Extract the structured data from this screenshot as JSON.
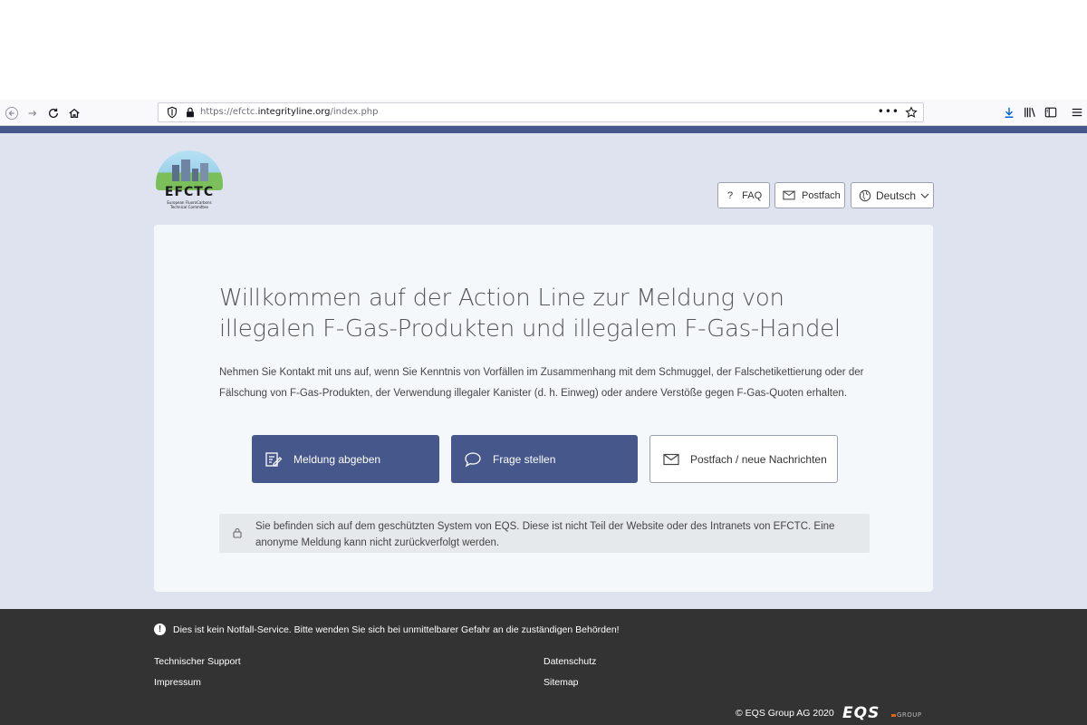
{
  "browser": {
    "url_prefix": "https://efctc.",
    "url_domain": "integrityline.org",
    "url_path": "/index.php",
    "more_label": "•••"
  },
  "logo": {
    "title": "EFCTC",
    "subtitle_line1": "European FluoroCarbons",
    "subtitle_line2": "Technical Committee"
  },
  "header": {
    "faq_label": "FAQ",
    "postfach_label": "Postfach",
    "language_label": "Deutsch"
  },
  "main": {
    "title": "Willkommen auf der Action Line zur Meldung von illegalen F-Gas-Produkten und illegalem F-Gas-Handel",
    "intro": "Nehmen Sie Kontakt mit uns auf, wenn Sie Kenntnis von Vorfällen im Zusammenhang mit dem Schmuggel, der Falschetikettierung oder der Fälschung von F-Gas-Produkten, der Verwendung illegaler Kanister (d. h. Einweg) oder andere Verstöße gegen F-Gas-Quoten erhalten.",
    "actions": [
      {
        "label": "Meldung abgeben",
        "icon": "edit-icon"
      },
      {
        "label": "Frage stellen",
        "icon": "chat-icon"
      },
      {
        "label": "Postfach / neue Nachrichten",
        "icon": "mail-icon"
      }
    ],
    "notice": "Sie befinden sich auf dem geschützten System von EQS. Diese ist nicht Teil der Website oder des Intranets von EFCTC. Eine anonyme Meldung kann nicht zurückverfolgt werden."
  },
  "footer": {
    "warning": "Dies ist kein Notfall-Service. Bitte wenden Sie sich bei unmittelbarer Gefahr an die zuständigen Behörden!",
    "links": [
      "Technischer Support",
      "Impressum",
      "Datenschutz",
      "Sitemap"
    ],
    "copyright": "© EQS Group AG 2020",
    "brand": "EQS",
    "brand_suffix": "GROUP"
  },
  "colors": {
    "accent": "#45578b",
    "page_background": "#dfe3f0",
    "footer": "#333333",
    "brand_orange": "#e2611d"
  }
}
